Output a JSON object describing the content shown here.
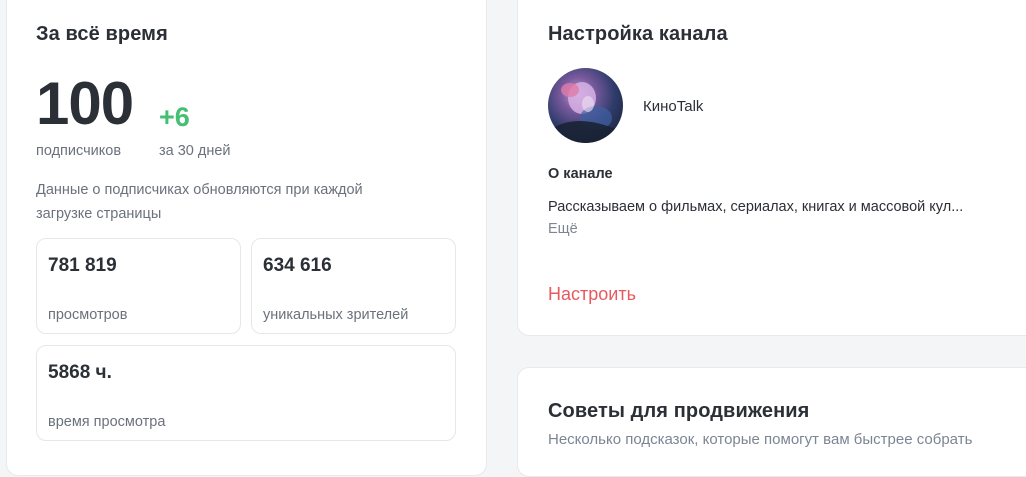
{
  "stats": {
    "title": "За всё время",
    "subscribers_value": "100",
    "subscribers_label": "подписчиков",
    "delta_value": "+6",
    "delta_label": "за 30 дней",
    "note": "Данные о подписчиках обновляются при каждой загрузке страницы",
    "metrics": [
      {
        "value": "781 819",
        "label": "просмотров"
      },
      {
        "value": "634 616",
        "label": "уникальных зрителей"
      },
      {
        "value": "5868 ч.",
        "label": "время просмотра"
      }
    ]
  },
  "settings": {
    "title": "Настройка канала",
    "channel_name": "КиноTalk",
    "about_title": "О канале",
    "about_text": "Рассказываем о фильмах, сериалах, книгах и массовой кул...",
    "more_link": "Ещё",
    "setup_link": "Настроить"
  },
  "tips": {
    "title": "Советы для продвижения",
    "subtitle": "Несколько подсказок, которые помогут вам быстрее собрать"
  },
  "colors": {
    "accent_green": "#45bf74",
    "accent_red": "#e8585e",
    "text_primary": "#2b2f36",
    "text_muted": "#6b717c"
  }
}
